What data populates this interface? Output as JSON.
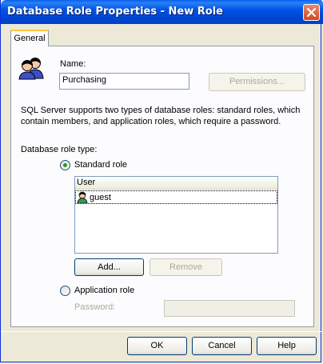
{
  "window": {
    "title": "Database Role Properties - New Role"
  },
  "tabs": [
    {
      "label": "General",
      "active": true
    }
  ],
  "general": {
    "name_label": "Name:",
    "name_value": "Purchasing",
    "permissions_button": "Permissions...",
    "description": "SQL Server supports two types of database roles: standard roles, which contain members, and application roles, which require a password.",
    "role_type_label": "Database role type:",
    "standard_role_label": "Standard role",
    "standard_role_selected": true,
    "members_table": {
      "columns": [
        "User"
      ],
      "rows": [
        {
          "user": "guest"
        }
      ]
    },
    "add_button": "Add...",
    "remove_button": "Remove",
    "application_role_label": "Application role",
    "application_role_selected": false,
    "password_label": "Password:",
    "password_value": ""
  },
  "footer": {
    "ok_button": "OK",
    "cancel_button": "Cancel",
    "help_button": "Help"
  },
  "icons": {
    "role": "users-icon",
    "member": "user-icon",
    "close": "close-icon"
  },
  "colors": {
    "titlebar": "#0055E5",
    "dialog_bg": "#ECE9D8",
    "panel_bg": "#FCFCFE",
    "close_button": "#D2471F",
    "radio_dot": "#21A121"
  }
}
